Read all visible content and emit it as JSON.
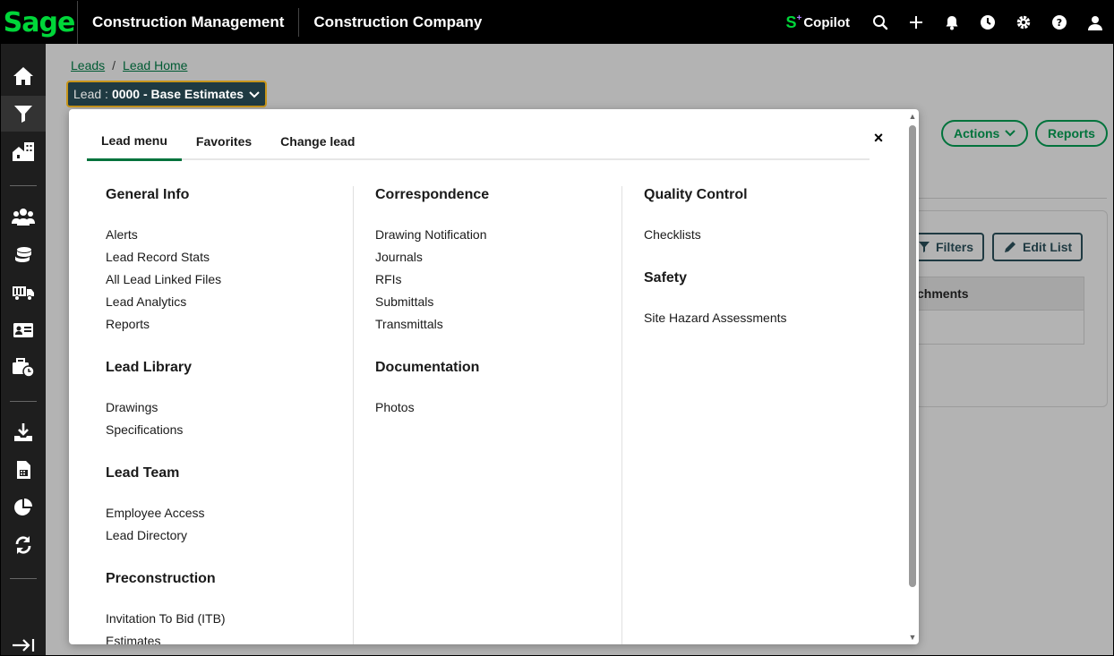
{
  "header": {
    "logo": "Sage",
    "app_title": "Construction Management",
    "company": "Construction Company",
    "copilot_label": "Copilot",
    "icons": [
      "search-icon",
      "plus-icon",
      "bell-icon",
      "clock-icon",
      "gear-icon",
      "help-icon",
      "user-icon"
    ]
  },
  "sidebar": {
    "items": [
      "home-icon",
      "filter-icon",
      "buildings-icon",
      "people-icon",
      "coins-icon",
      "truck-icon",
      "id-card-icon",
      "briefcase-clock-icon",
      "download-icon",
      "calculator-icon",
      "pie-chart-icon",
      "sync-icon"
    ],
    "active": "filter-icon",
    "collapse_icon": "expand-arrow-icon"
  },
  "breadcrumb": {
    "leads": "Leads",
    "separator": "/",
    "lead_home": "Lead Home"
  },
  "lead_selector": {
    "prefix": "Lead :",
    "name": "0000 - Base Estimates"
  },
  "background": {
    "actions_label": "Actions",
    "reports_label": "Reports",
    "filters_label": "Filters",
    "edit_list_label": "Edit List",
    "table_header": "chments"
  },
  "popover": {
    "tabs": [
      "Lead menu",
      "Favorites",
      "Change lead"
    ],
    "active_tab": "Lead menu",
    "close": "×",
    "columns": [
      [
        {
          "title": "General Info",
          "items": [
            "Alerts",
            "Lead Record Stats",
            "All Lead Linked Files",
            "Lead Analytics",
            "Reports"
          ]
        },
        {
          "title": "Lead Library",
          "items": [
            "Drawings",
            "Specifications"
          ]
        },
        {
          "title": "Lead Team",
          "items": [
            "Employee Access",
            "Lead Directory"
          ]
        },
        {
          "title": "Preconstruction",
          "items": [
            "Invitation To Bid (ITB)",
            "Estimates"
          ]
        }
      ],
      [
        {
          "title": "Correspondence",
          "items": [
            "Drawing Notification",
            "Journals",
            "RFIs",
            "Submittals",
            "Transmittals"
          ]
        },
        {
          "title": "Documentation",
          "items": [
            "Photos"
          ]
        }
      ],
      [
        {
          "title": "Quality Control",
          "items": [
            "Checklists"
          ]
        },
        {
          "title": "Safety",
          "items": [
            "Site Hazard Assessments"
          ]
        }
      ]
    ]
  },
  "colors": {
    "brand_green": "#00d639",
    "accent_green": "#00733c",
    "selector_bg": "#1f3a42",
    "selector_border": "#c8961b"
  }
}
